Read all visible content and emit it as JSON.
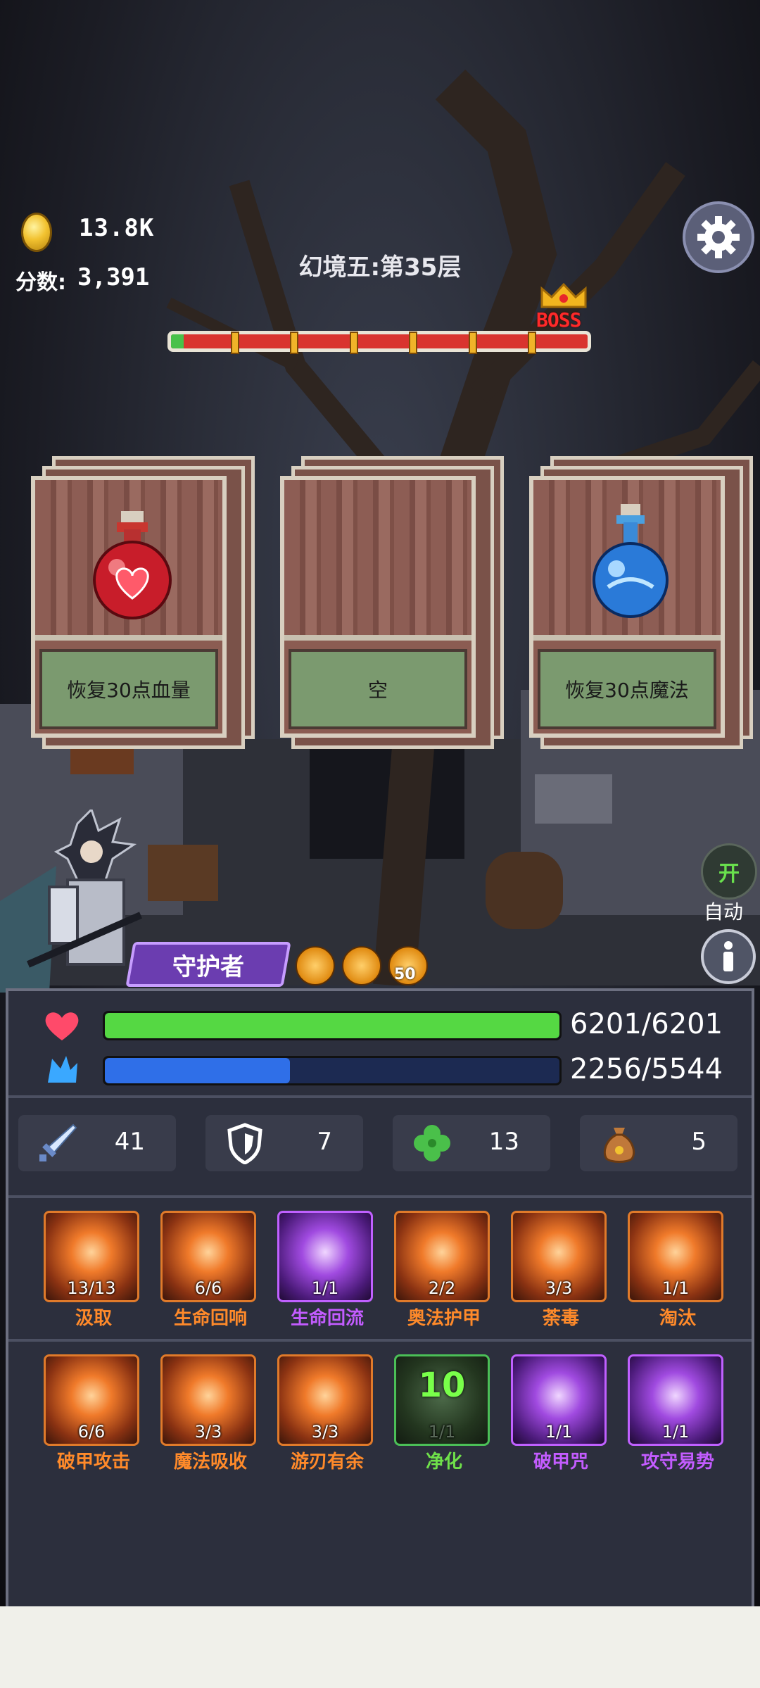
{
  "hud": {
    "gold": "13.8K",
    "score_label": "分数:",
    "score_value": "3,391",
    "stage_title": "幻境五:第35层",
    "boss_label": "BOSS",
    "progress": 0.03,
    "segments": 7
  },
  "cards": [
    {
      "label": "恢复30点血量",
      "item": "red-potion-icon"
    },
    {
      "label": "空",
      "item": "none"
    },
    {
      "label": "恢复30点魔法",
      "item": "blue-potion-icon"
    }
  ],
  "controls": {
    "auto_toggle": "开",
    "auto_label": "自动"
  },
  "hero": {
    "class_name": "守护者",
    "buff_count": "50"
  },
  "stats": {
    "hp": {
      "current": 6201,
      "max": 6201,
      "text": "6201/6201",
      "color": "#55d843"
    },
    "mp": {
      "current": 2256,
      "max": 5544,
      "text": "2256/5544",
      "color": "#2f6fe8"
    }
  },
  "attributes": [
    {
      "icon": "sword-icon",
      "value": "41"
    },
    {
      "icon": "shield-icon",
      "value": "7"
    },
    {
      "icon": "clover-icon",
      "value": "13"
    },
    {
      "icon": "money-bag-icon",
      "value": "5"
    }
  ],
  "skills_row1": [
    {
      "name": "汲取",
      "level": "13/13",
      "style": "orange"
    },
    {
      "name": "生命回响",
      "level": "6/6",
      "style": "orange"
    },
    {
      "name": "生命回流",
      "level": "1/1",
      "style": "purple"
    },
    {
      "name": "奥法护甲",
      "level": "2/2",
      "style": "orange"
    },
    {
      "name": "荼毒",
      "level": "3/3",
      "style": "orange"
    },
    {
      "name": "淘汰",
      "level": "1/1",
      "style": "orange"
    }
  ],
  "skills_row2": [
    {
      "name": "破甲攻击",
      "level": "6/6",
      "style": "orange"
    },
    {
      "name": "魔法吸收",
      "level": "3/3",
      "style": "orange"
    },
    {
      "name": "游刃有余",
      "level": "3/3",
      "style": "orange"
    },
    {
      "name": "净化",
      "level": "1/1",
      "style": "green",
      "cooldown": "10"
    },
    {
      "name": "破甲咒",
      "level": "1/1",
      "style": "purple"
    },
    {
      "name": "攻守易势",
      "level": "1/1",
      "style": "purple"
    }
  ]
}
